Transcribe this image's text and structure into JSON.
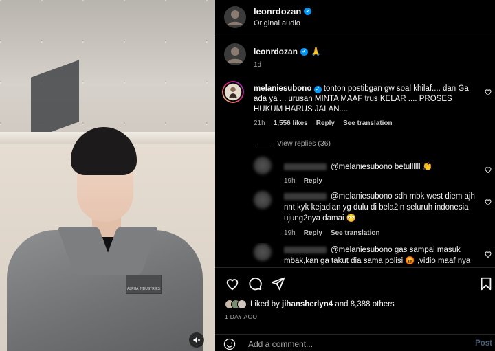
{
  "post": {
    "username": "leonrdozan",
    "audio_label": "Original audio",
    "caption_username": "leonrdozan",
    "caption_emoji": "🙏",
    "caption_time": "1d"
  },
  "comments": [
    {
      "username": "melaniesubono",
      "text": "tonton postibgan gw soal khilaf.... dan Ga ada ya ... urusan MINTA MAAF trus KELAR .... PROSES HUKUM HARUS JALAN....",
      "time": "21h",
      "likes": "1,556 likes",
      "reply": "Reply",
      "translation": "See translation"
    }
  ],
  "view_replies": "View replies (36)",
  "replies": [
    {
      "text": "@melaniesubono betullllll 👏",
      "time": "19h",
      "reply": "Reply"
    },
    {
      "text": "@melaniesubono sdh mbk west diem ajh nnt kyk kejadian yg dulu di bela2in seluruh indonesia ujung2nya damai 😳",
      "time": "19h",
      "reply": "Reply",
      "translation": "See translation"
    },
    {
      "text": "@melaniesubono gas sampai masuk mbak,kan ga takut dia sama polisi 😡 ,vidio maaf nya"
    }
  ],
  "likes": {
    "prefix": "Liked by ",
    "user": "jihansherlyn4",
    "suffix": " and 8,388 others"
  },
  "date_label": "1 DAY AGO",
  "comment_box": {
    "placeholder": "Add a comment...",
    "post_label": "Post"
  },
  "video_patch_text": "ALPHA INDUSTRIES",
  "colors": {
    "verified": "#0095f6",
    "muted_text": "#a8a8a8",
    "post_button": "#4a5d74"
  }
}
